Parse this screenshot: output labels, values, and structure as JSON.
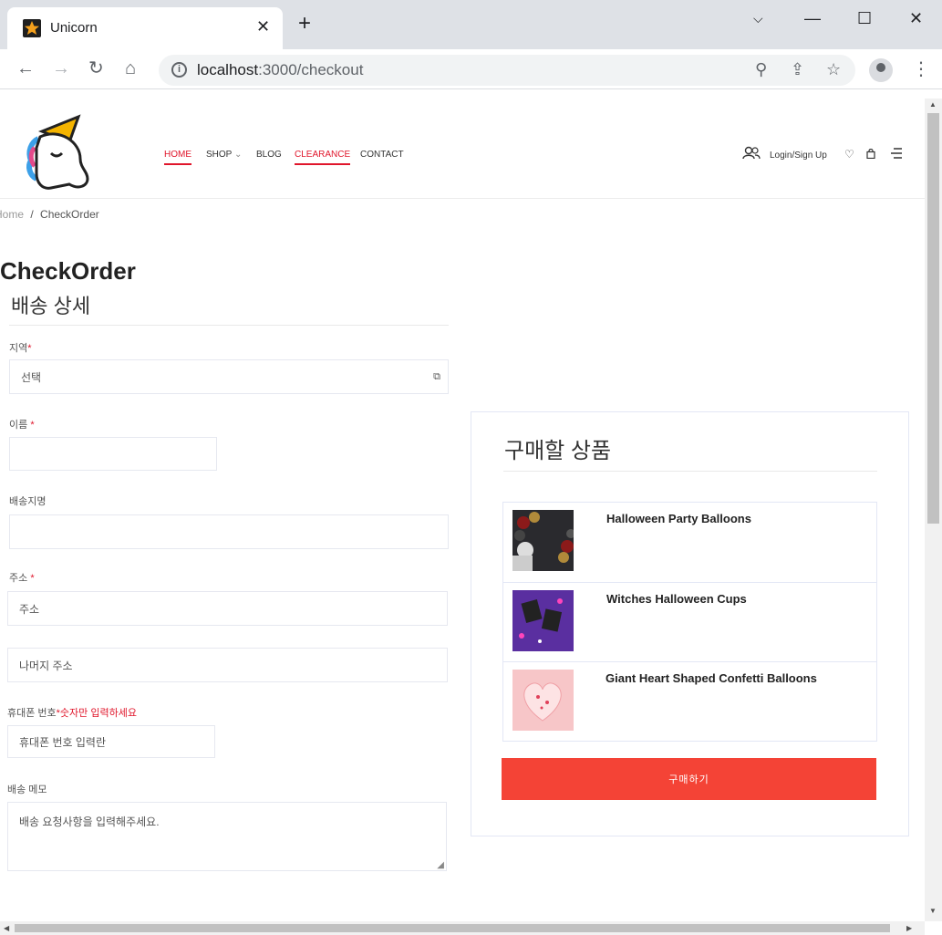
{
  "browser": {
    "tab_title": "Unicorn",
    "url_host": "localhost",
    "url_rest": ":3000/checkout"
  },
  "nav": {
    "items": [
      "HOME",
      "SHOP",
      "BLOG",
      "CLEARANCE",
      "CONTACT"
    ],
    "shop_chevron": "⌄",
    "login": "Login/Sign Up"
  },
  "breadcrumb": {
    "home": "Home",
    "separator": "/",
    "current": "CheckOrder"
  },
  "page_title": "CheckOrder",
  "form": {
    "section_title": "배송 상세",
    "region_label": "지역",
    "region_value": "선택",
    "name_label": "이름",
    "place_label": "배송지명",
    "address_label": "주소",
    "address_placeholder": "주소",
    "address_detail_placeholder": "나머지 주소",
    "phone_label": "휴대폰 번호",
    "phone_hint": "*숫자만 입력하세요",
    "phone_placeholder": "휴대폰 번호 입력란",
    "memo_label": "배송 메모",
    "memo_placeholder": "배송 요청사항을 입력해주세요.",
    "required_mark": "*"
  },
  "order": {
    "title": "구매할 상품",
    "products": [
      {
        "name": "Halloween Party Balloons"
      },
      {
        "name": "Witches Halloween Cups"
      },
      {
        "name": "Giant Heart Shaped Confetti Balloons"
      }
    ],
    "buy_button": "구매하기"
  },
  "colors": {
    "accent": "#e0162b",
    "buy_button": "#f44336"
  }
}
